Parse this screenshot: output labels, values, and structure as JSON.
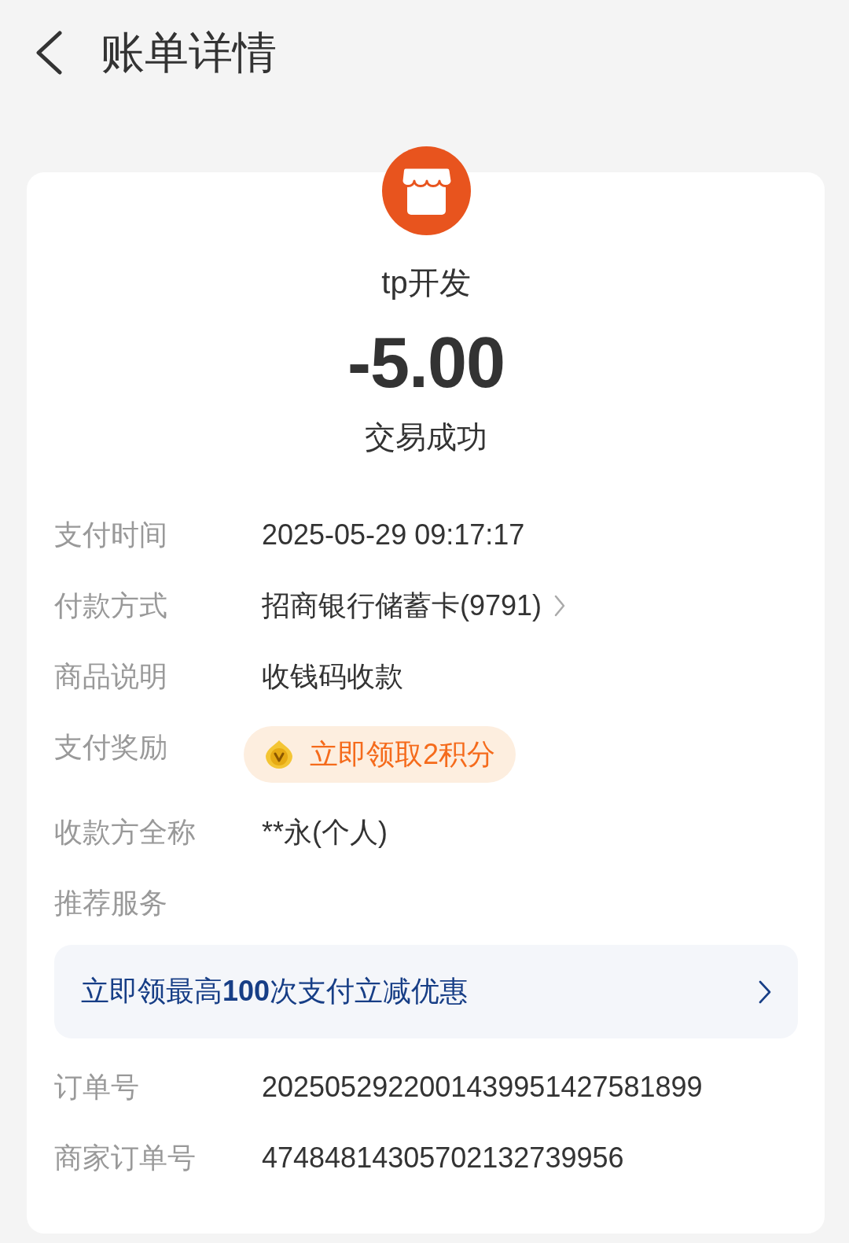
{
  "header": {
    "title": "账单详情"
  },
  "summary": {
    "merchant": "tp开发",
    "amount": "-5.00",
    "status": "交易成功"
  },
  "details": [
    {
      "kind": "text",
      "label": "支付时间",
      "value": "2025-05-29 09:17:17"
    },
    {
      "kind": "link",
      "label": "付款方式",
      "value": "招商银行储蓄卡(9791)"
    },
    {
      "kind": "text",
      "label": "商品说明",
      "value": "收钱码收款"
    },
    {
      "kind": "reward",
      "label": "支付奖励",
      "value": "立即领取2积分"
    },
    {
      "kind": "text",
      "label": "收款方全称",
      "value": "**永(个人)"
    }
  ],
  "recommended_services": {
    "label": "推荐服务",
    "banner": "立即领最高**100**次支付立减优惠"
  },
  "order_info": [
    {
      "label": "订单号",
      "value": "2025052922001439951427581899"
    },
    {
      "label": "商家订单号",
      "value": "47484814305702132739956"
    }
  ]
}
